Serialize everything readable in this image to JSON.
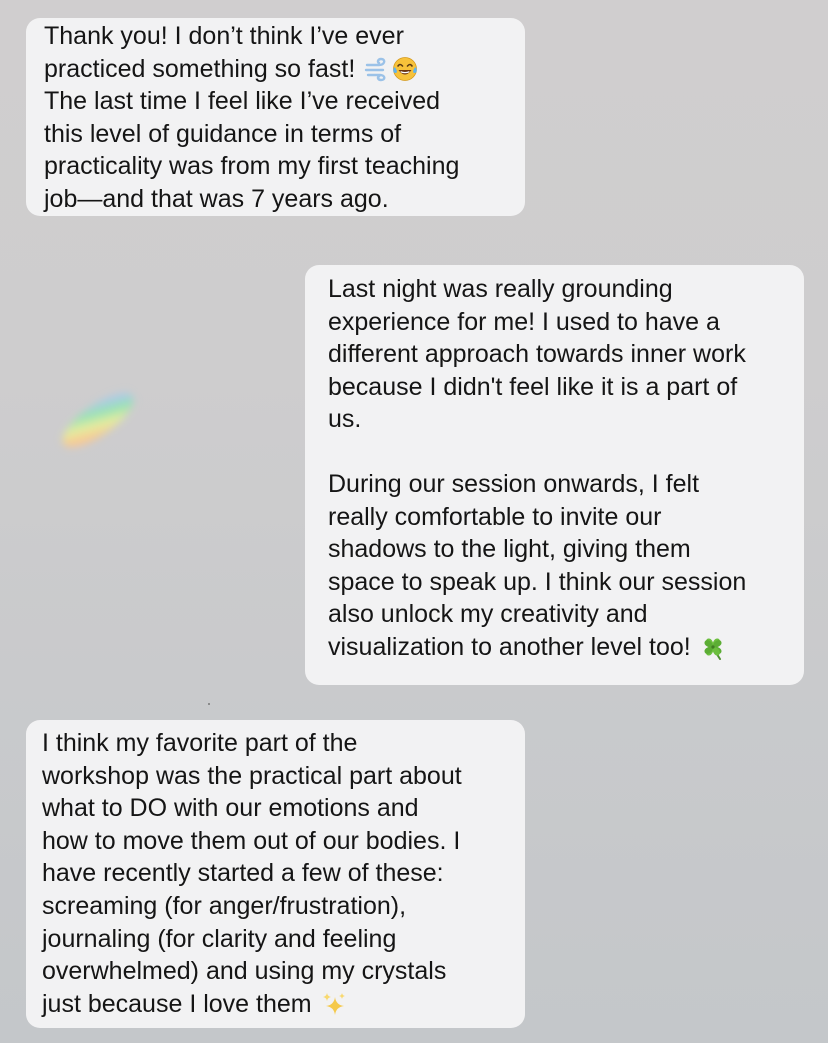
{
  "messages": [
    {
      "side": "left",
      "paragraphs": [
        "Thank you! I don’t think I’ve ever\npracticed something so fast!",
        "The last time I feel like I’ve received\nthis level of guidance in terms of\npracticality was from my first teaching\njob—and that was 7 years ago."
      ],
      "emojis": [
        "dash-icon",
        "tears-of-joy-icon"
      ]
    },
    {
      "side": "right",
      "paragraphs": [
        "Last night was really grounding\nexperience for me! I used to have a\ndifferent approach towards inner work\nbecause I didn't feel like it is a part of\nus.",
        "During our session onwards, I felt\nreally comfortable to invite our\nshadows to the light, giving them\nspace to speak up. I think our session\nalso unlock my creativity and\nvisualization to another level too!"
      ],
      "emojis": [
        "four-leaf-clover-icon"
      ]
    },
    {
      "side": "left",
      "paragraphs": [
        "I think my favorite part of the\nworkshop was the practical part about\nwhat to DO with our emotions and\nhow to move them out of our bodies. I\nhave recently started a few of these:\nscreaming (for anger/frustration),\njournaling (for clarity and feeling\noverwhelmed) and using my crystals\njust because I love them"
      ],
      "emojis": [
        "sparkles-icon"
      ]
    }
  ],
  "colors": {
    "bubble": "#f2f2f3",
    "text": "#151515",
    "background": "#cdcccd"
  }
}
